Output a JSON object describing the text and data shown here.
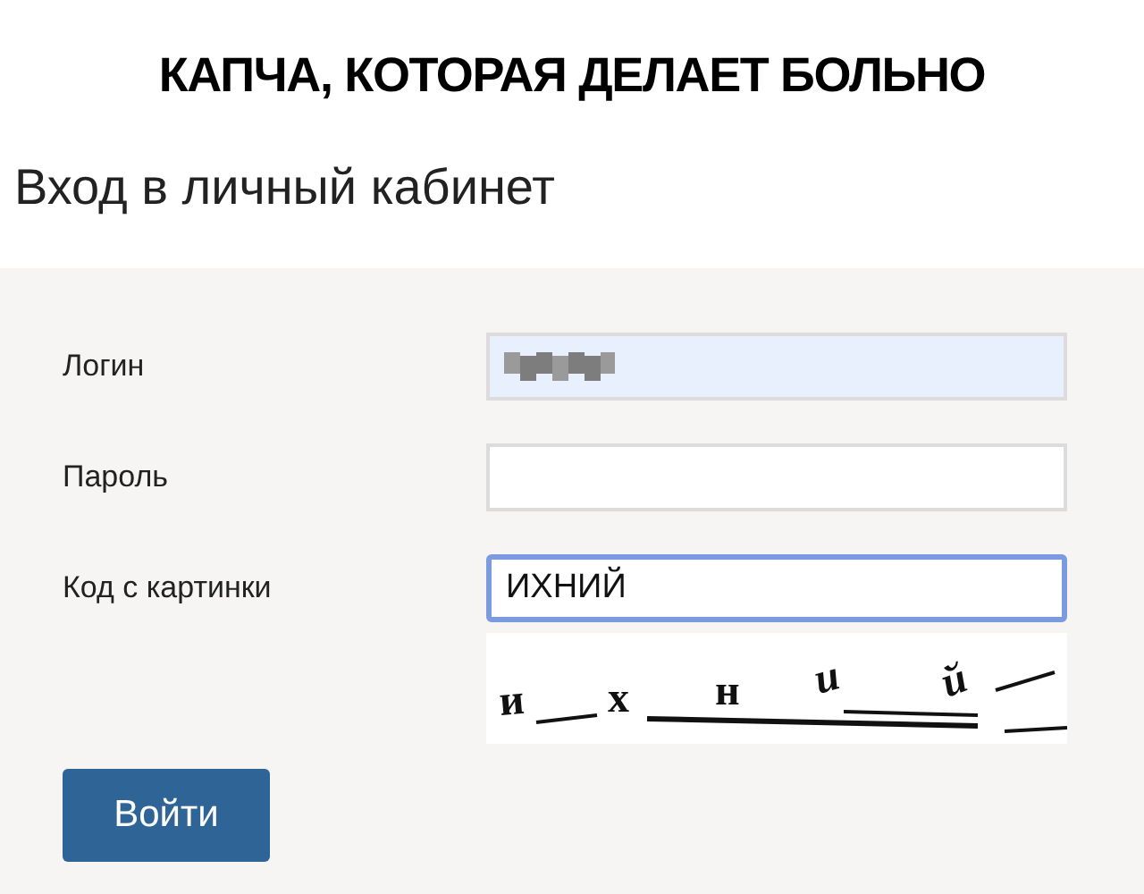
{
  "caption": "КАПЧА, КОТОРАЯ ДЕЛАЕТ БОЛЬНО",
  "title": "Вход в личный кабинет",
  "fields": [
    {
      "label": "Логин",
      "kind": "text",
      "autofilled": true,
      "redacted": true,
      "focused": false
    },
    {
      "label": "Пароль",
      "kind": "password",
      "autofilled": false,
      "redacted": false,
      "focused": false
    },
    {
      "label": "Код с картинки",
      "kind": "text",
      "value": "ИХНИЙ",
      "autofilled": false,
      "redacted": false,
      "focused": true
    }
  ],
  "captcha": {
    "letters": [
      "и",
      "х",
      "н",
      "и",
      "й"
    ]
  },
  "submit": "Войти"
}
